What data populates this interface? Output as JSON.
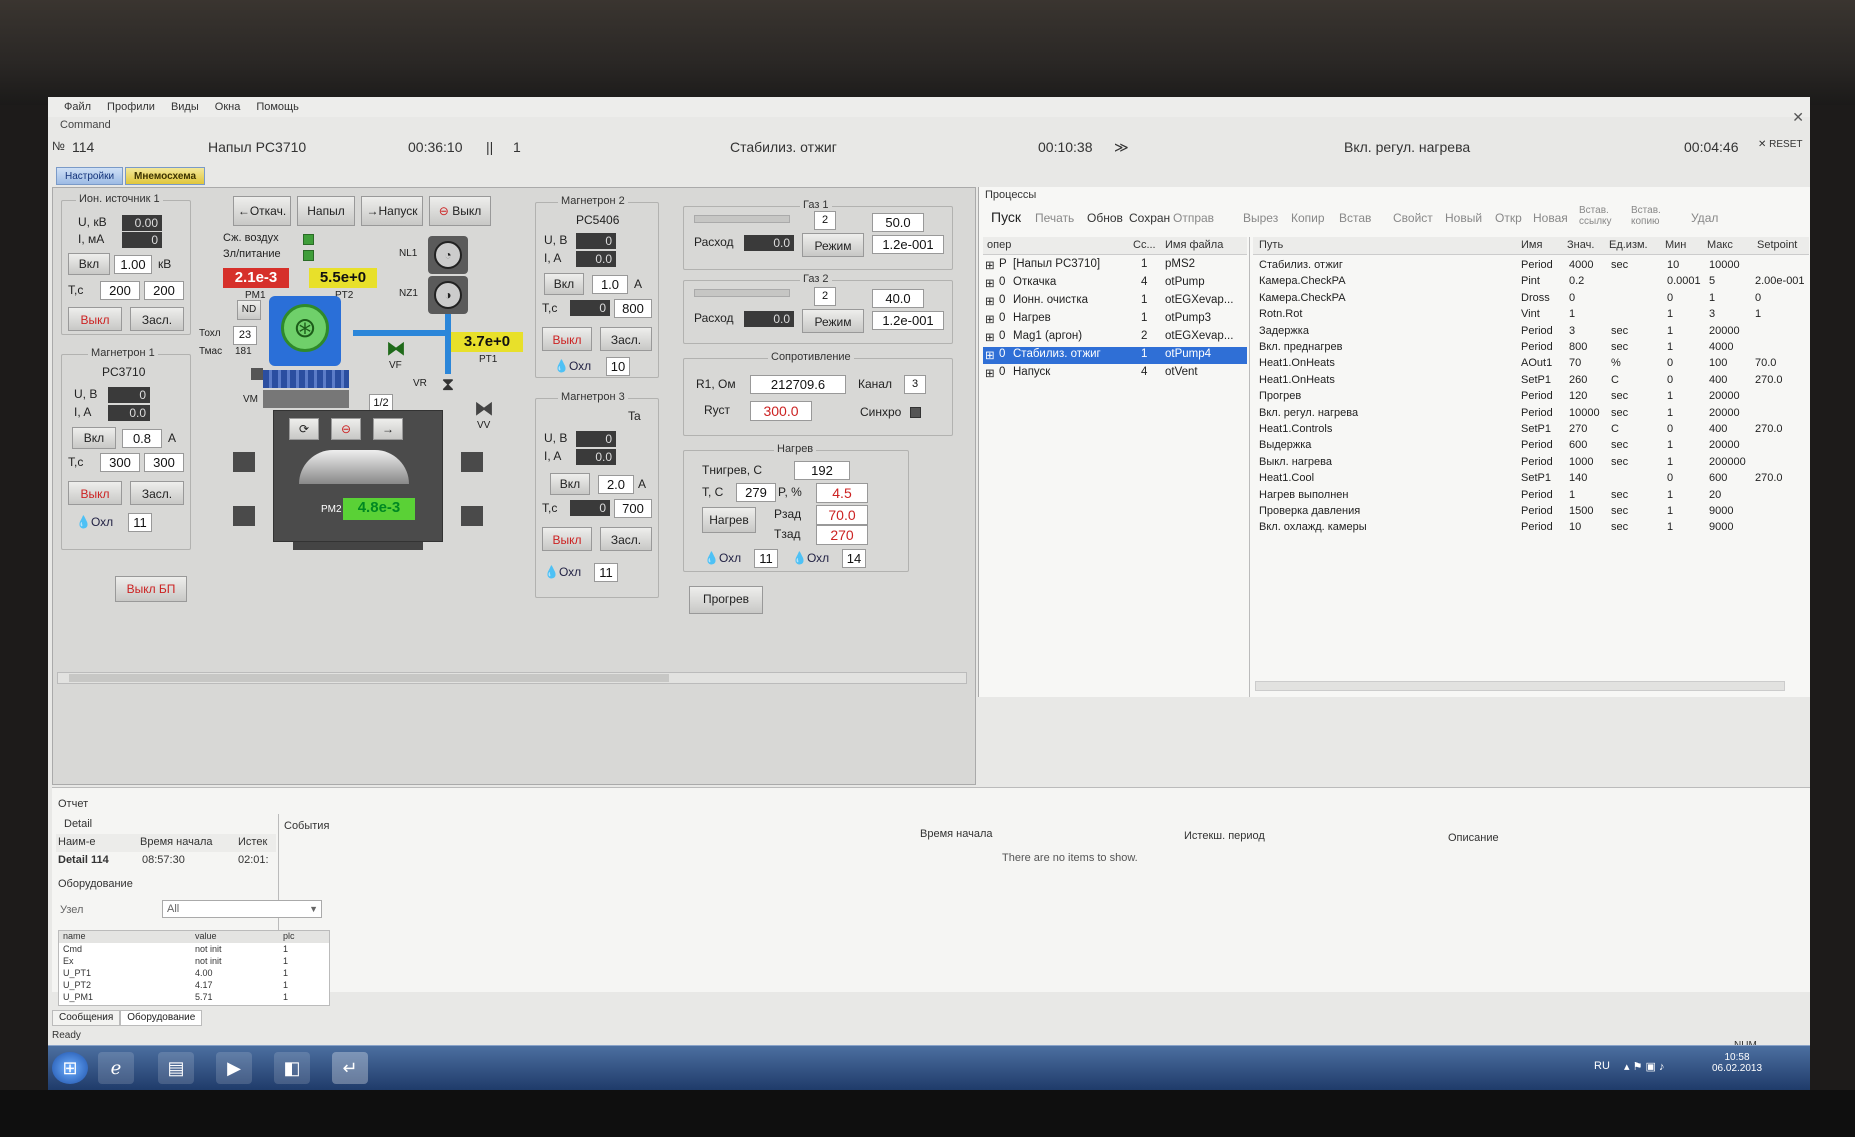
{
  "menu": [
    "Файл",
    "Профили",
    "Виды",
    "Окна",
    "Помощь"
  ],
  "command_label": "Command",
  "cmd": {
    "no_label": "№",
    "no": "114",
    "title": "Напыл PC3710",
    "time1": "00:36:10",
    "sep": "||",
    "step": "1",
    "stage": "Стабилиз. отжиг",
    "time2": "00:10:38",
    "arrow": "≫",
    "next_stage": "Вкл. регул. нагрева",
    "time3": "00:04:46",
    "reset": "✕ RESET"
  },
  "tabs": [
    "Настройки",
    "Мнемосхема"
  ],
  "ion_source": {
    "title": "Ион. источник 1",
    "u_label": "U, кВ",
    "u": "0.00",
    "i_label": "I, мА",
    "i": "0",
    "on": "Вкл",
    "set": "1.00",
    "unit": "кВ",
    "t_label": "T,c",
    "t1": "200",
    "t2": "200",
    "off": "Выкл",
    "shutter": "Засл."
  },
  "magnetron1": {
    "title": "Магнетрон 1",
    "target": "PC3710",
    "u_label": "U, B",
    "u": "0",
    "i_label": "I, A",
    "i": "0.0",
    "on": "Вкл",
    "set": "0.8",
    "unit": "A",
    "t_label": "T,c",
    "t1": "300",
    "t2": "300",
    "off": "Выкл",
    "shutter": "Засл.",
    "cool": "Охл",
    "cool_n": "11"
  },
  "power_off": "Выкл БП",
  "pumping": {
    "btn_pump": "←Откач.",
    "btn_fill": "Напыл",
    "btn_vent": "→Напуск",
    "btn_off": "Выкл",
    "air_label": "Сж. воздух",
    "supply_label": "Зл/питание",
    "pm1": "2.1e-3",
    "pm1_label": "PM1",
    "pt2": "5.5e+0",
    "pt2_label": "PT2",
    "pt1": "3.7e+0",
    "pt1_label": "PT1",
    "pm2": "4.8e-3",
    "pm2_label": "PM2",
    "nd": "ND",
    "nl1": "NL1",
    "nz1": "NZ1",
    "vf": "VF",
    "vr": "VR",
    "vv": "VV",
    "vm": "VM",
    "half": "1/2",
    "tohl_label": "Тохл",
    "tohl": "23",
    "tmas_label": "Тмас",
    "tmas": "181"
  },
  "magnetron2": {
    "title": "Магнетрон 2",
    "target": "PC5406",
    "u_label": "U, B",
    "u": "0",
    "i_label": "I, A",
    "i": "0.0",
    "on": "Вкл",
    "set": "1.0",
    "unit": "A",
    "t_label": "T,c",
    "t1": "0",
    "t2": "800",
    "off": "Выкл",
    "shutter": "Засл.",
    "cool": "Охл",
    "cool_n": "10"
  },
  "magnetron3": {
    "title": "Магнетрон 3",
    "target": "Ta",
    "u_label": "U, B",
    "u": "0",
    "i_label": "I, A",
    "i": "0.0",
    "on": "Вкл",
    "set": "2.0",
    "unit": "A",
    "t_label": "T,c",
    "t1": "0",
    "t2": "700",
    "off": "Выкл",
    "shutter": "Засл.",
    "cool": "Охл",
    "cool_n": "11"
  },
  "gas1": {
    "title": "Газ 1",
    "n": "2",
    "flow_label": "Расход",
    "flow": "0.0",
    "mode": "Режим",
    "set": "50.0",
    "val": "1.2e-001"
  },
  "gas2": {
    "title": "Газ 2",
    "n": "2",
    "flow_label": "Расход",
    "flow": "0.0",
    "mode": "Режим",
    "set": "40.0",
    "val": "1.2e-001"
  },
  "resistance": {
    "title": "Сопротивление",
    "r_label": "R1, Ом",
    "r": "212709.6",
    "ch_label": "Канал",
    "ch": "3",
    "rset_label": "Rуст",
    "rset": "300.0",
    "sync_label": "Синхро"
  },
  "heating": {
    "title": "Нагрев",
    "tnom_label": "Тнигрев, С",
    "tnom": "192",
    "t_label": "T, C",
    "t": "279",
    "p_label": "P, %",
    "p": "4.5",
    "btn": "Нагрев",
    "pset_label": "Pзад",
    "pset": "70.0",
    "tset_label": "Tзад",
    "tset": "270",
    "cool1": "Охл",
    "cool1_n": "11",
    "cool2": "Охл",
    "cool2_n": "14",
    "preheat": "Прогрев"
  },
  "processes": {
    "title": "Процессы",
    "toolbar": [
      "Пуск",
      "Печать",
      "Обнов",
      "Сохран",
      "Отправ",
      "Вырез",
      "Копир",
      "Встав",
      "Свойст",
      "Новый",
      "Откр",
      "Новая",
      "Встав. ссылку",
      "Встав. копию",
      "Удал"
    ],
    "tree_headers": [
      "опер",
      "Сс...",
      "Имя файла"
    ],
    "tree": [
      {
        "mark": "P",
        "name": "[Напыл PC3710]",
        "n": "1",
        "file": "pMS2",
        "sel": false
      },
      {
        "mark": "0",
        "name": "Откачка",
        "n": "4",
        "file": "otPump",
        "sel": false
      },
      {
        "mark": "0",
        "name": "Ионн. очистка",
        "n": "1",
        "file": "otEGXevap...",
        "sel": false
      },
      {
        "mark": "0",
        "name": "Нагрев",
        "n": "1",
        "file": "otPump3",
        "sel": false
      },
      {
        "mark": "0",
        "name": "Mag1 (аргон)",
        "n": "2",
        "file": "otEGXevap...",
        "sel": false
      },
      {
        "mark": "0",
        "name": "Стабилиз. отжиг",
        "n": "1",
        "file": "otPump4",
        "sel": true
      },
      {
        "mark": "0",
        "name": "Напуск",
        "n": "4",
        "file": "otVent",
        "sel": false
      }
    ],
    "param_headers": [
      "Путь",
      "Имя",
      "Знач.",
      "Ед.изм.",
      "Мин",
      "Макс",
      "Setpoint"
    ],
    "params": [
      [
        "Стабилиз. отжиг",
        "Period",
        "4000",
        "sec",
        "10",
        "10000",
        ""
      ],
      [
        "Камера.CheckPA",
        "Pint",
        "0.2",
        "",
        "0.0001",
        "5",
        "2.00e-001"
      ],
      [
        "Камера.CheckPA",
        "Dross",
        "0",
        "",
        "0",
        "1",
        "0"
      ],
      [
        "Rotn.Rot",
        "Vint",
        "1",
        "",
        "1",
        "3",
        "1"
      ],
      [
        "Задержка",
        "Period",
        "3",
        "sec",
        "1",
        "20000",
        ""
      ],
      [
        "Вкл. преднагрев",
        "Period",
        "800",
        "sec",
        "1",
        "4000",
        ""
      ],
      [
        "Heat1.OnHeats",
        "AOut1",
        "70",
        "%",
        "0",
        "100",
        "70.0"
      ],
      [
        "Heat1.OnHeats",
        "SetP1",
        "260",
        "C",
        "0",
        "400",
        "270.0"
      ],
      [
        "Прогрев",
        "Period",
        "120",
        "sec",
        "1",
        "20000",
        ""
      ],
      [
        "Вкл. регул. нагрева",
        "Period",
        "10000",
        "sec",
        "1",
        "20000",
        ""
      ],
      [
        "Heat1.Controls",
        "SetP1",
        "270",
        "C",
        "0",
        "400",
        "270.0"
      ],
      [
        "Выдержка",
        "Period",
        "600",
        "sec",
        "1",
        "20000",
        ""
      ],
      [
        "Выкл. нагрева",
        "Period",
        "1000",
        "sec",
        "1",
        "200000",
        ""
      ],
      [
        "Heat1.Cool",
        "SetP1",
        "140",
        "",
        "0",
        "600",
        "270.0"
      ],
      [
        "Нагрев выполнен",
        "Period",
        "1",
        "sec",
        "1",
        "20",
        ""
      ],
      [
        "Проверка давления",
        "Period",
        "1500",
        "sec",
        "1",
        "9000",
        ""
      ],
      [
        "Вкл. охлажд. камеры",
        "Period",
        "10",
        "sec",
        "1",
        "9000",
        ""
      ]
    ]
  },
  "report": {
    "title": "Отчет",
    "detail_label": "Detail",
    "detail_headers": [
      "Наим-е",
      "Время начала",
      "Истек"
    ],
    "detail_row": [
      "Detail 114",
      "08:57:30",
      "02:01:"
    ],
    "events_label": "События",
    "events_headers": [
      "Время начала",
      "Истекш. период",
      "Описание"
    ],
    "empty": "There are no items to show."
  },
  "equipment": {
    "title": "Оборудование",
    "node_label": "Узел",
    "node_value": "All",
    "headers": [
      "name",
      "value",
      "plc"
    ],
    "rows": [
      [
        "Cmd",
        "not init",
        "1"
      ],
      [
        "Ex",
        "not init",
        "1"
      ],
      [
        "U_PT1",
        "4.00",
        "1"
      ],
      [
        "U_PT2",
        "4.17",
        "1"
      ],
      [
        "U_PM1",
        "5.71",
        "1"
      ]
    ],
    "tabs": [
      "Сообщения",
      "Оборудование"
    ]
  },
  "status": {
    "ready": "Ready",
    "num": "NUM"
  },
  "tray": {
    "lang": "RU",
    "time": "10:58",
    "date": "06.02.2013"
  },
  "colors": {
    "selection": "#2f6fd6",
    "alarm_red": "#d6302a",
    "warn_yellow": "#e8e02a",
    "ok_green": "#5ad136"
  }
}
